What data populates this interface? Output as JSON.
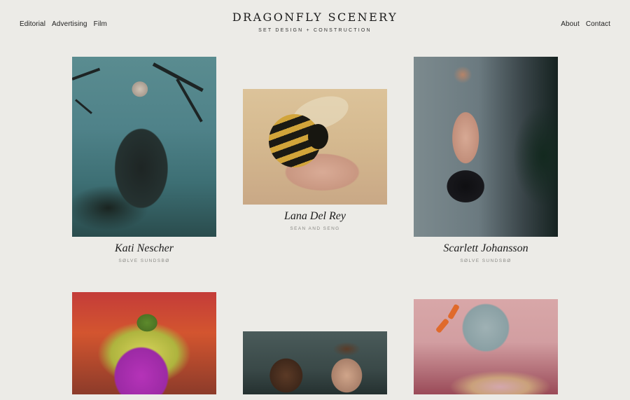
{
  "nav_left": [
    "Editorial",
    "Advertising",
    "Film"
  ],
  "brand": {
    "title": "DRAGONFLY SCENERY",
    "subtitle": "SET DESIGN + CONSTRUCTION"
  },
  "nav_right": [
    "About",
    "Contact"
  ],
  "gallery": [
    {
      "title": "Kati Nescher",
      "credit": "SØLVE SUNDSBØ"
    },
    {
      "title": "Lana Del Rey",
      "credit": "SEAN AND SENG"
    },
    {
      "title": "Scarlett Johansson",
      "credit": "SØLVE SUNDSBØ"
    },
    {
      "title": "",
      "credit": ""
    },
    {
      "title": "",
      "credit": ""
    },
    {
      "title": "",
      "credit": ""
    }
  ]
}
